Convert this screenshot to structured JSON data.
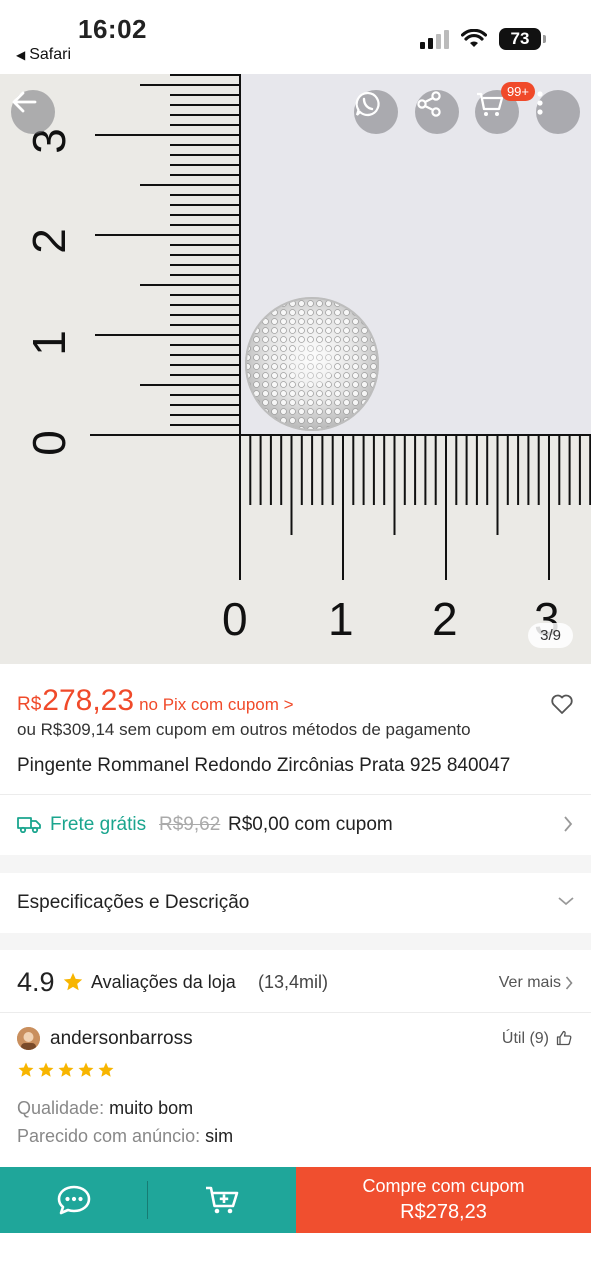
{
  "status_bar": {
    "time": "16:02",
    "back_app": "Safari",
    "battery": "73"
  },
  "product_image": {
    "ruler_left_labels": [
      "3",
      "2",
      "1",
      "0"
    ],
    "ruler_bottom_labels": [
      "0",
      "1",
      "2",
      "3"
    ],
    "cart_badge": "99+",
    "counter": "3/9",
    "icons": [
      "arrow-left-icon",
      "whatsapp-icon",
      "share-icon",
      "cart-icon",
      "more-vertical-icon"
    ]
  },
  "price": {
    "currency": "R$",
    "amount": "278,23",
    "pix_label": "no Pix com cupom >",
    "alt_price": "ou R$309,14 sem cupom em outros métodos de pagamento",
    "title": "Pingente Rommanel Redondo Zircônias Prata 925 840047"
  },
  "shipping": {
    "free_label": "Frete grátis",
    "old_price": "R$9,62",
    "coupon_price": "R$0,00 com cupom"
  },
  "specs": {
    "label": "Especificações e Descrição"
  },
  "reviews": {
    "rating": "4.9",
    "title": "Avaliações da loja",
    "count": "(13,4mil)",
    "see_more": "Ver mais",
    "item": {
      "user": "andersonbarross",
      "useful": "Útil (9)",
      "stars": 5,
      "quality_label": "Qualidade:",
      "quality_value": "muito bom",
      "similar_label": "Parecido com anúncio:",
      "similar_value": "sim"
    }
  },
  "bottom_bar": {
    "buy_line1": "Compre com cupom",
    "buy_line2": "R$278,23"
  },
  "colors": {
    "accent_orange": "#f04a2a",
    "teal": "#1fa69a",
    "free_shipping_green": "#1aa58e",
    "star_yellow": "#f7b500"
  }
}
